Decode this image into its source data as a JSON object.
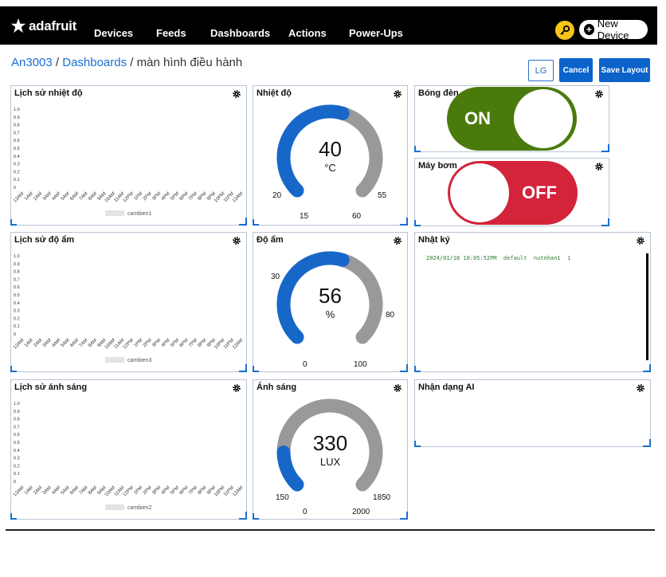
{
  "brand": {
    "logo_text": "adafruit"
  },
  "nav": {
    "items": [
      "Devices",
      "Feeds",
      "Dashboards",
      "Actions",
      "Power-Ups"
    ],
    "new_device_label": "New Device"
  },
  "breadcrumb": {
    "user": "An3003",
    "section": "Dashboards",
    "sep": "/",
    "current": "màn hình điều hành"
  },
  "toolbar": {
    "lg_label": "LG",
    "cancel_label": "Cancel",
    "save_label": "Save Layout"
  },
  "history_ticks": [
    "12AM",
    "1AM",
    "2AM",
    "3AM",
    "4AM",
    "5AM",
    "6AM",
    "7AM",
    "8AM",
    "9AM",
    "10AM",
    "11AM",
    "12PM",
    "1PM",
    "2PM",
    "3PM",
    "4PM",
    "5PM",
    "6PM",
    "7PM",
    "8PM",
    "9PM",
    "10PM",
    "11PM",
    "12AM"
  ],
  "history_y": [
    "1.0",
    "0.9",
    "0.8",
    "0.7",
    "0.6",
    "0.5",
    "0.4",
    "0.3",
    "0.2",
    "0.1",
    "0"
  ],
  "blocks": {
    "temp_history": {
      "title": "Lịch sử nhiệt độ",
      "legend": "cambien1"
    },
    "humid_history": {
      "title": "Lịch sử độ ẩm",
      "legend": "cambien3"
    },
    "light_history": {
      "title": "Lịch sử ánh sáng",
      "legend": "cambien2"
    },
    "temp_gauge": {
      "title": "Nhiệt độ",
      "value": "40",
      "unit": "°C",
      "min": "15",
      "max": "60",
      "low": "20",
      "high": "55",
      "fraction": 0.56
    },
    "humid_gauge": {
      "title": "Độ ẩm",
      "value": "56",
      "unit": "%",
      "min": "0",
      "max": "100",
      "low": "30",
      "high": "80",
      "fraction": 0.56
    },
    "light_gauge": {
      "title": "Ánh sáng",
      "value": "330",
      "unit": "LUX",
      "min": "0",
      "max": "2000",
      "low": "150",
      "high": "1850",
      "fraction": 0.165
    },
    "light_switch": {
      "title": "Bóng đèn",
      "state": "ON"
    },
    "pump_switch": {
      "title": "Máy bơm",
      "state": "OFF"
    },
    "log": {
      "title": "Nhật ký",
      "entry": "2024/01/18 10:05:52PM  default  nutnhan1  1"
    },
    "ai": {
      "title": "Nhận dạng AI"
    }
  },
  "colors": {
    "blue": "#0b63c9",
    "gauge_blue": "#1767c9",
    "gauge_gray": "#999999",
    "on_green": "#4a7a0c",
    "off_red": "#d3243a",
    "key_yellow": "#f5c518"
  }
}
